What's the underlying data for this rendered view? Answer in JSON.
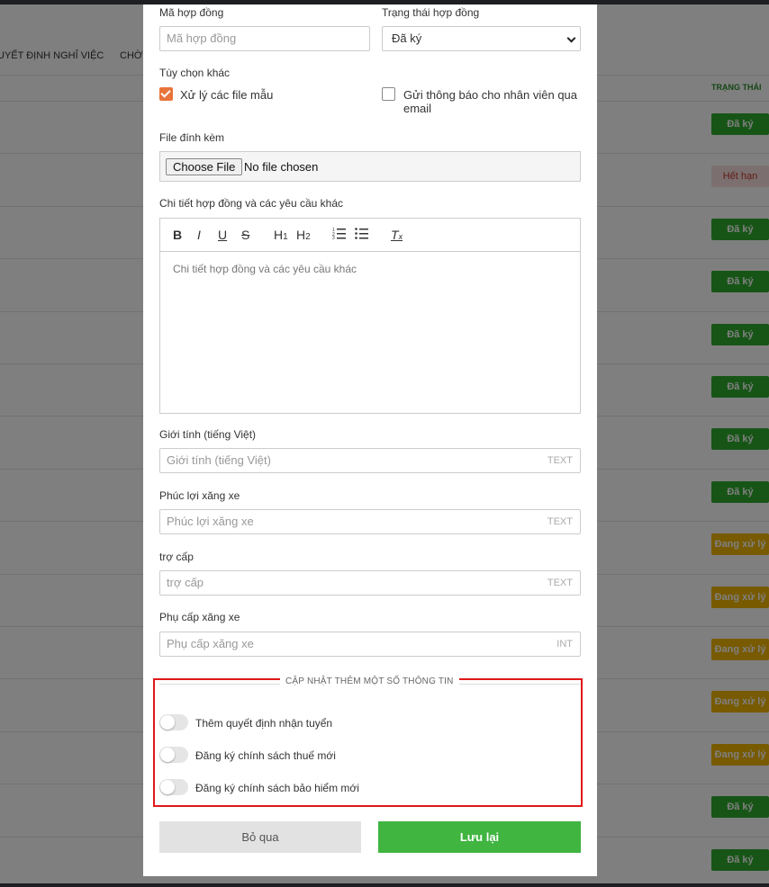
{
  "background": {
    "tabs": [
      "UYẾT ĐỊNH NGHỈ VIỆC",
      "CHỜ"
    ],
    "column_header": "TRẠNG THÁI",
    "rows": [
      {
        "status": "Đã ký",
        "color": "#2eaa2e"
      },
      {
        "status": "Hết hạn",
        "color": "#f7dede"
      },
      {
        "status": "Đã ký",
        "color": "#2eaa2e"
      },
      {
        "status": "Đã ký",
        "color": "#2eaa2e"
      },
      {
        "status": "Đã ký",
        "color": "#2eaa2e"
      },
      {
        "status": "Đã ký",
        "color": "#2eaa2e"
      },
      {
        "status": "Đã ký",
        "color": "#2eaa2e"
      },
      {
        "status": "Đã ký",
        "color": "#2eaa2e"
      },
      {
        "status": "Đang xử lý",
        "color": "#f0b400"
      },
      {
        "status": "Đang xử lý",
        "color": "#f0b400"
      },
      {
        "status": "Đang xử lý",
        "color": "#f0b400"
      },
      {
        "status": "Đang xử lý",
        "color": "#f0b400"
      },
      {
        "status": "Đang xử lý",
        "color": "#f0b400"
      },
      {
        "status": "Đã ký",
        "color": "#2eaa2e"
      },
      {
        "status": "Đã ký",
        "color": "#2eaa2e"
      }
    ]
  },
  "form": {
    "contract_code": {
      "label": "Mã hợp đồng",
      "placeholder": "Mã hợp đồng",
      "value": ""
    },
    "contract_status": {
      "label": "Trạng thái hợp đồng",
      "value": "Đã ký"
    },
    "other_options": {
      "label": "Tùy chọn khác",
      "process_templates": {
        "label": "Xử lý các file mẫu",
        "checked": true
      },
      "notify_email": {
        "label_line1": "Gửi thông báo cho nhân viên qua",
        "label_line2": "email",
        "checked": false
      }
    },
    "attachment": {
      "label": "File đính kèm",
      "button": "Choose File",
      "status": "No file chosen"
    },
    "details": {
      "label": "Chi tiết hợp đồng và các yêu cầu khác",
      "placeholder": "Chi tiết hợp đồng và các yêu cầu khác",
      "toolbar": [
        "bold-icon",
        "italic-icon",
        "underline-icon",
        "strikethrough-icon",
        "heading1-icon",
        "heading2-icon",
        "ordered-list-icon",
        "bullet-list-icon",
        "clear-format-icon"
      ]
    },
    "gender": {
      "label": "Giới tính (tiếng Việt)",
      "placeholder": "Giới tính (tiếng Việt)",
      "type": "TEXT"
    },
    "fuel_benefit": {
      "label": "Phúc lợi xăng xe",
      "placeholder": "Phúc lợi xăng xe",
      "type": "TEXT"
    },
    "allowance": {
      "label": "trợ cấp",
      "placeholder": "trợ cấp",
      "type": "TEXT"
    },
    "fuel_allowance": {
      "label": "Phụ cấp xăng xe",
      "placeholder": "Phụ cấp xăng xe",
      "type": "INT"
    },
    "extra_section": {
      "title": "CẬP NHẬT THÊM MỘT SỐ THÔNG TIN",
      "highlight_color": "#e01818",
      "toggles": [
        {
          "label": "Thêm quyết định nhận tuyển",
          "on": false
        },
        {
          "label": "Đăng ký chính sách thuế mới",
          "on": false
        },
        {
          "label": "Đăng ký chính sách bảo hiểm mới",
          "on": false
        }
      ]
    },
    "buttons": {
      "cancel": "Bỏ qua",
      "save": "Lưu lại",
      "save_color": "#40b540"
    }
  }
}
